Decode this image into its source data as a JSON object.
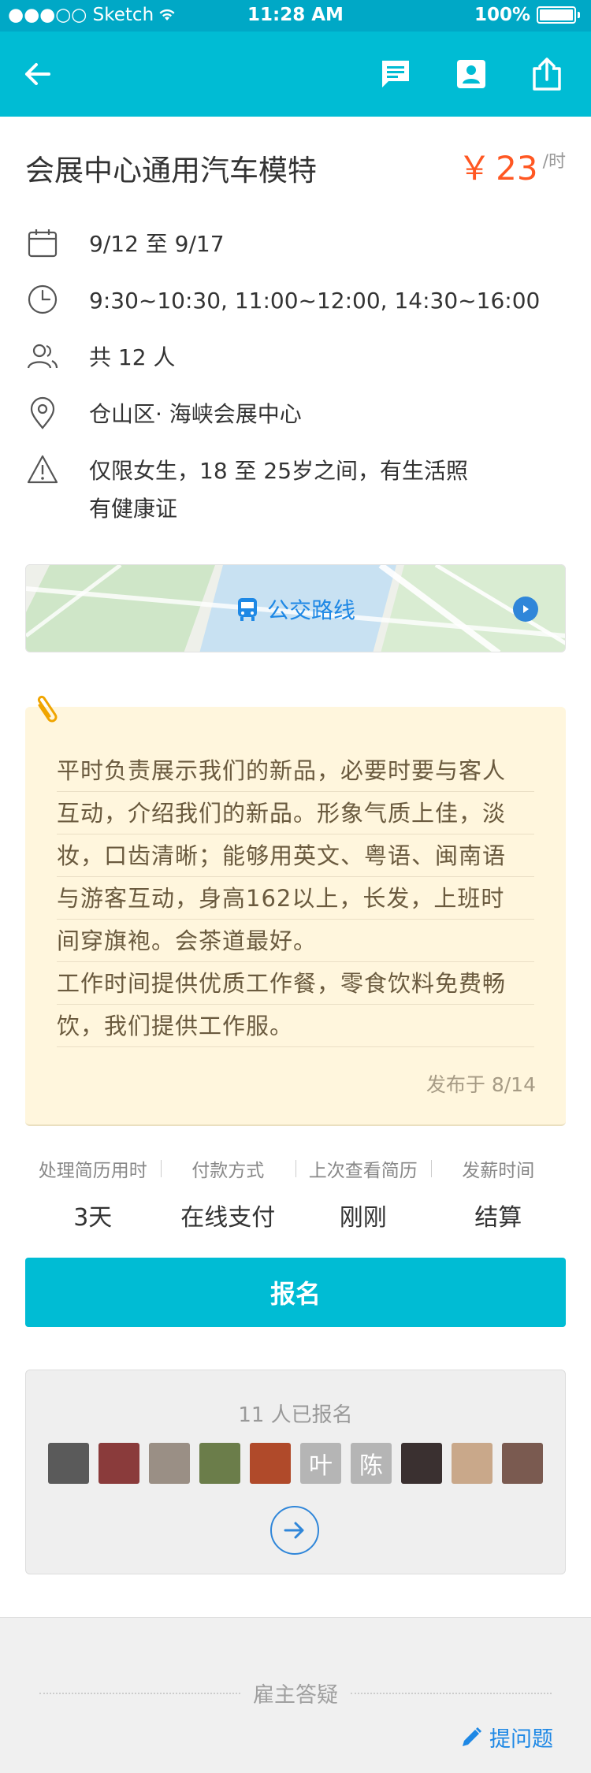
{
  "status_bar": {
    "carrier": "●●●○○ Sketch",
    "time": "11:28 AM",
    "battery": "100%"
  },
  "nav": {
    "back_icon": "arrow-left-icon",
    "message_icon": "message-icon",
    "contact_icon": "contact-card-icon",
    "share_icon": "share-icon"
  },
  "job": {
    "title": "会展中心通用汽车模特",
    "price_currency": "￥",
    "price_value": "23",
    "price_unit": "/时"
  },
  "info": {
    "date": "9/12 至 9/17",
    "time": "9:30~10:30, 11:00~12:00, 14:30~16:00",
    "headcount": "共 12 人",
    "location": "仓山区· 海峡会展中心",
    "requirement_line1": "仅限女生，18 至 25岁之间，有生活照",
    "requirement_line2": "有健康证"
  },
  "bus_route": {
    "label": "公交路线"
  },
  "description": {
    "lines": [
      "平时负责展示我们的新品，必要时要与客人",
      "互动，介绍我们的新品。形象气质上佳，淡",
      "妆，口齿清晰；能够用英文、粤语、闽南语",
      "与游客互动，身高162以上，长发，上班时",
      "间穿旗袍。会茶道最好。",
      "工作时间提供优质工作餐，零食饮料免费畅",
      "饮，我们提供工作服。"
    ],
    "posted": "发布于 8/14"
  },
  "stats": [
    {
      "label": "处理简历用时",
      "value": "3天"
    },
    {
      "label": "付款方式",
      "value": "在线支付"
    },
    {
      "label": "上次查看简历",
      "value": "刚刚"
    },
    {
      "label": "发薪时间",
      "value": "结算"
    }
  ],
  "signup": {
    "label": "报名"
  },
  "applicants": {
    "count_text": "11 人已报名",
    "avatars": [
      {
        "text": "",
        "color": "#5a5a5a"
      },
      {
        "text": "",
        "color": "#8a3b3b"
      },
      {
        "text": "",
        "color": "#9a8f85"
      },
      {
        "text": "",
        "color": "#6b7d4a"
      },
      {
        "text": "",
        "color": "#b04a2a"
      },
      {
        "text": "叶",
        "color": "#b5b5b5"
      },
      {
        "text": "陈",
        "color": "#b5b5b5"
      },
      {
        "text": "",
        "color": "#3a3030"
      },
      {
        "text": "",
        "color": "#c9a88a"
      },
      {
        "text": "",
        "color": "#7a5a50"
      }
    ]
  },
  "qa": {
    "title": "雇主答疑",
    "ask_label": "提问题"
  }
}
